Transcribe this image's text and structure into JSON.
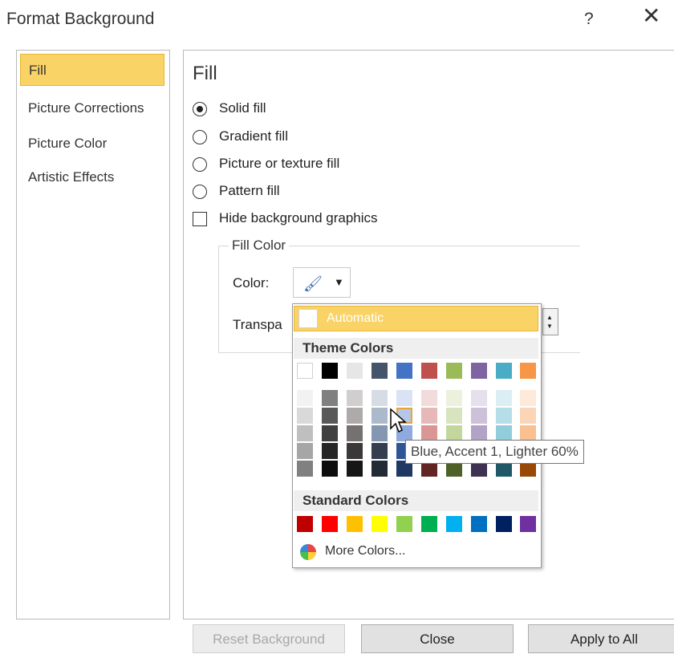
{
  "dialog": {
    "title": "Format Background",
    "help_label": "?",
    "close_label": "✕"
  },
  "sidebar": {
    "items": [
      {
        "label": "Fill",
        "selected": true
      },
      {
        "label": "Picture Corrections",
        "selected": false
      },
      {
        "label": "Picture Color",
        "selected": false
      },
      {
        "label": "Artistic Effects",
        "selected": false
      }
    ]
  },
  "fill": {
    "heading": "Fill",
    "options": [
      {
        "label": "Solid fill",
        "selected": true
      },
      {
        "label": "Gradient fill",
        "selected": false
      },
      {
        "label": "Picture or texture fill",
        "selected": false
      },
      {
        "label": "Pattern fill",
        "selected": false
      }
    ],
    "hide_background": {
      "label": "Hide background graphics",
      "checked": false
    },
    "fill_color_group": "Fill Color",
    "color_label": "Color:",
    "transparency_label": "Transpa"
  },
  "color_picker": {
    "automatic_label": "Automatic",
    "theme_colors_label": "Theme Colors",
    "standard_colors_label": "Standard Colors",
    "more_colors_label": "More Colors...",
    "tooltip": "Blue, Accent 1, Lighter 60%",
    "theme_top": [
      "#ffffff",
      "#000000",
      "#e7e6e6",
      "#44546a",
      "#4472c4",
      "#c0504d",
      "#9bbb59",
      "#8064a2",
      "#4bacc6",
      "#f79646"
    ],
    "theme_shades": [
      [
        "#f2f2f2",
        "#d9d9d9",
        "#bfbfbf",
        "#a6a6a6",
        "#808080"
      ],
      [
        "#808080",
        "#595959",
        "#404040",
        "#262626",
        "#0d0d0d"
      ],
      [
        "#d0cece",
        "#aeaaaa",
        "#757171",
        "#3a3838",
        "#161616"
      ],
      [
        "#d6dce4",
        "#acb9ca",
        "#8497b0",
        "#333f4f",
        "#222a35"
      ],
      [
        "#dae3f3",
        "#b4c7e7",
        "#8faadc",
        "#2f5597",
        "#203864"
      ],
      [
        "#f2dcdb",
        "#e6b9b8",
        "#d99694",
        "#953735",
        "#632523"
      ],
      [
        "#ebf1dd",
        "#d7e4bd",
        "#c3d69b",
        "#76923c",
        "#4f6128"
      ],
      [
        "#e5e0ec",
        "#ccc1d9",
        "#b3a2c7",
        "#5f497a",
        "#3f3151"
      ],
      [
        "#dbeef3",
        "#b7dde8",
        "#92cddc",
        "#31859b",
        "#205867"
      ],
      [
        "#fdeada",
        "#fbd5b5",
        "#fac08f",
        "#e46c0a",
        "#984807"
      ]
    ],
    "standard": [
      "#c00000",
      "#ff0000",
      "#ffc000",
      "#ffff00",
      "#92d050",
      "#00b050",
      "#00b0f0",
      "#0070c0",
      "#002060",
      "#7030a0"
    ]
  },
  "buttons": {
    "reset": "Reset Background",
    "close": "Close",
    "apply_all": "Apply to All"
  }
}
